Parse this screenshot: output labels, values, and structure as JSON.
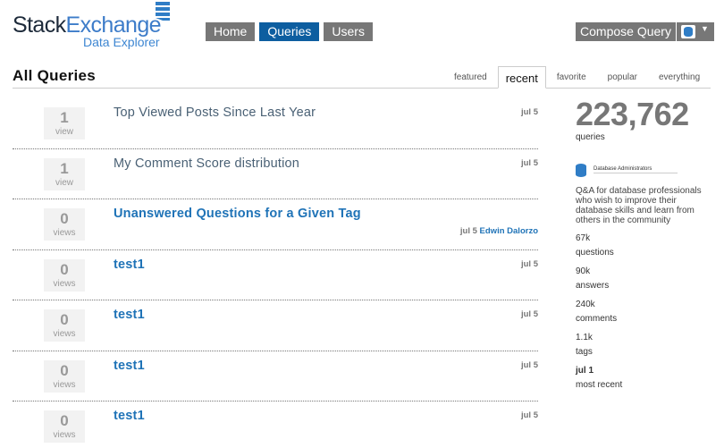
{
  "header": {
    "logo_part1": "Stack",
    "logo_part2": "Exchange",
    "logo_sub": "Data Explorer",
    "nav": [
      "Home",
      "Queries",
      "Users"
    ],
    "compose_label": "Compose Query",
    "caret": "▼"
  },
  "page_title": "All Queries",
  "tabs": [
    "featured",
    "recent",
    "favorite",
    "popular",
    "everything"
  ],
  "queries": [
    {
      "count": "1",
      "unit": "view",
      "title": "Top Viewed Posts Since Last Year",
      "date": "jul 5",
      "author": ""
    },
    {
      "count": "1",
      "unit": "view",
      "title": "My Comment Score distribution",
      "date": "jul 5",
      "author": ""
    },
    {
      "count": "0",
      "unit": "views",
      "title": "Unanswered Questions for a Given Tag",
      "date": "jul 5",
      "author": "Edwin Dalorzo"
    },
    {
      "count": "0",
      "unit": "views",
      "title": "test1",
      "date": "jul 5",
      "author": ""
    },
    {
      "count": "0",
      "unit": "views",
      "title": "test1",
      "date": "jul 5",
      "author": ""
    },
    {
      "count": "0",
      "unit": "views",
      "title": "test1",
      "date": "jul 5",
      "author": ""
    },
    {
      "count": "0",
      "unit": "views",
      "title": "test1",
      "date": "jul 5",
      "author": ""
    }
  ],
  "sidebar": {
    "total": "223,762",
    "total_label": "queries",
    "site_name": "Database Administrators",
    "description": "Q&A for database professionals who wish to improve their database skills and learn from others in the community",
    "stats": [
      {
        "value": "67k",
        "label": "questions"
      },
      {
        "value": "90k",
        "label": "answers"
      },
      {
        "value": "240k",
        "label": "comments"
      },
      {
        "value": "1.1k",
        "label": "tags"
      },
      {
        "value": "jul 1",
        "label": "most recent"
      }
    ]
  },
  "colors": {
    "accent": "#0d5ea0",
    "link": "#1f73b7",
    "button": "#777777"
  },
  "icons": {
    "site_select": "database-icon",
    "site_logo": "database-icon"
  }
}
